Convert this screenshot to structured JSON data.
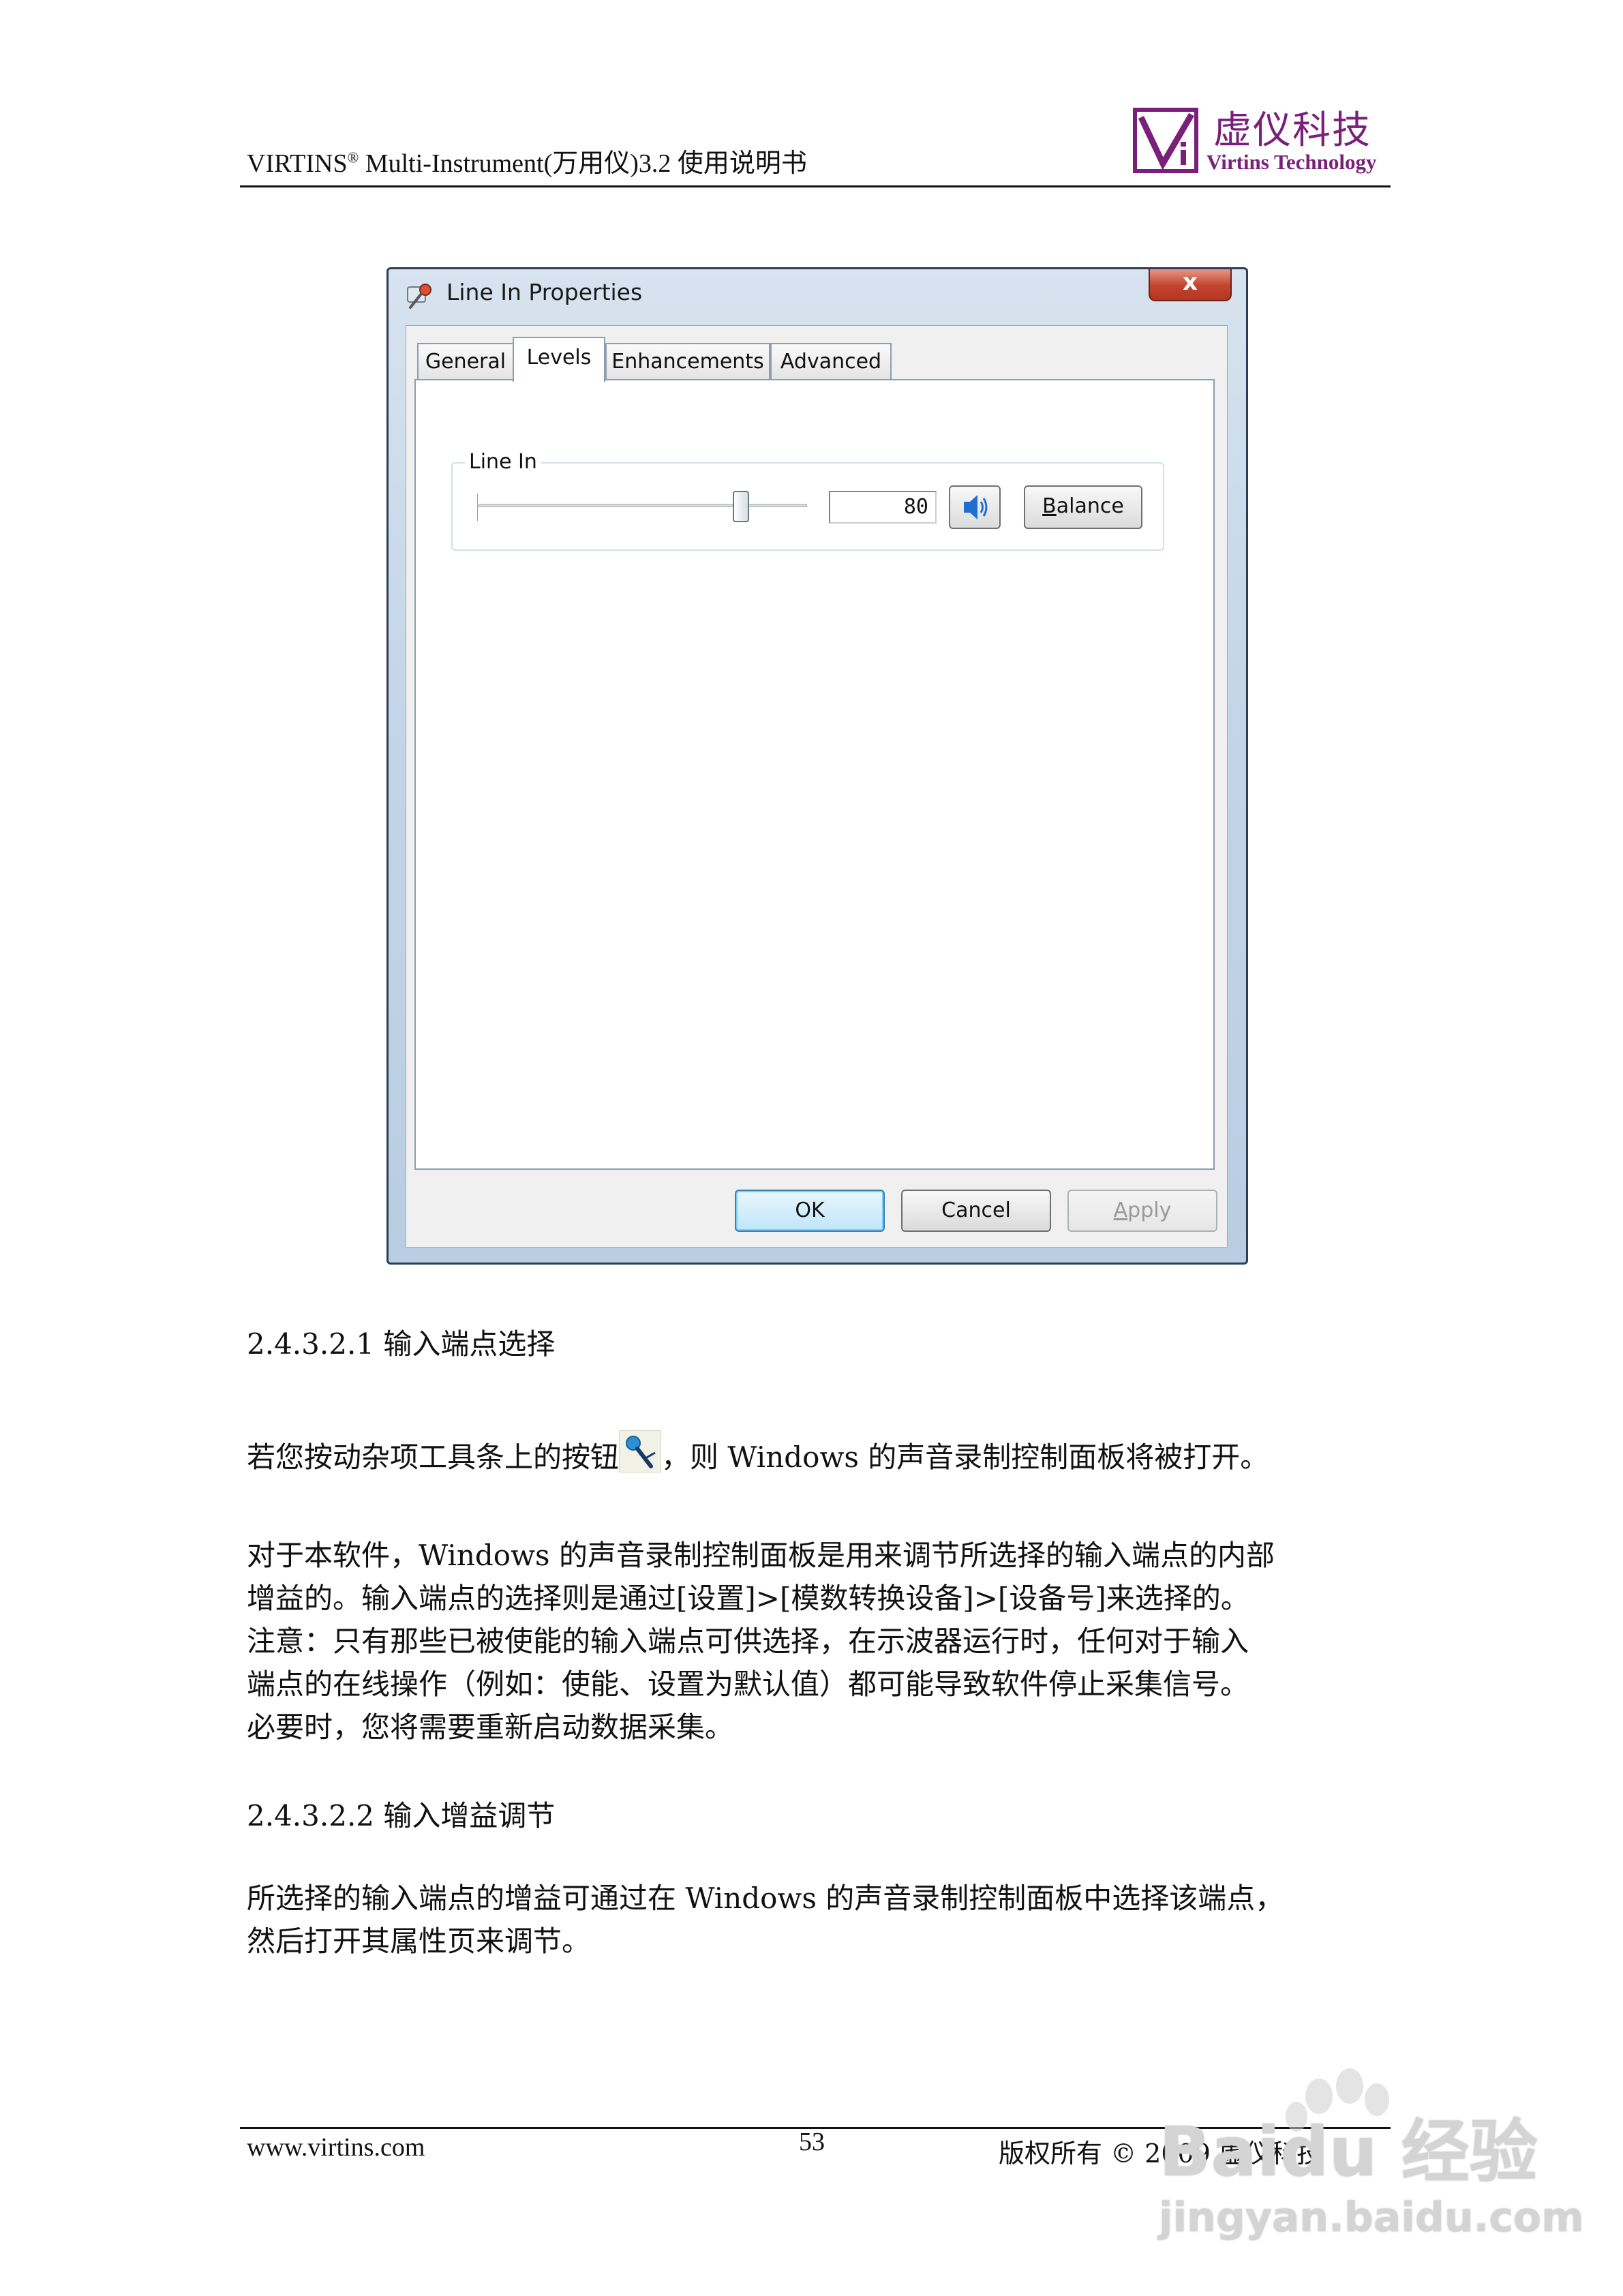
{
  "header": {
    "title_brand": "VIRTINS",
    "title_reg": "®",
    "title_rest": " Multi-Instrument(万用仪)3.2 使用说明书",
    "logo_cn": "虚仪科技",
    "logo_en": "Virtins Technology",
    "logo_color": "#7a1f7a"
  },
  "dialog": {
    "title": "Line In Properties",
    "close_glyph": "x",
    "tabs": [
      {
        "label": "General",
        "active": false
      },
      {
        "label": "Levels",
        "active": true
      },
      {
        "label": "Enhancements",
        "active": false
      },
      {
        "label": "Advanced",
        "active": false
      }
    ],
    "group_label": "Line In",
    "level_value": "80",
    "slider_fraction": 0.8,
    "speaker_icon": "speaker-icon",
    "balance_label_mnemonic": "B",
    "balance_label_rest": "alance",
    "ok_label": "OK",
    "cancel_label": "Cancel",
    "apply_label_mnemonic": "A",
    "apply_label_rest": "pply"
  },
  "body": {
    "section1_heading": "2.4.3.2.1 输入端点选择",
    "p1_before_icon": "若您按动杂项工具条上的按钮",
    "p1_icon": "microphone-icon",
    "p1_after_icon": "，则 Windows 的声音录制控制面板将被打开。",
    "p2_lines": [
      "对于本软件，Windows 的声音录制控制面板是用来调节所选择的输入端点的内部",
      "增益的。输入端点的选择则是通过[设置]>[模数转换设备]>[设备号]来选择的。",
      "注意：只有那些已被使能的输入端点可供选择，在示波器运行时，任何对于输入",
      "端点的在线操作（例如：使能、设置为默认值）都可能导致软件停止采集信号。",
      "必要时，您将需要重新启动数据采集。"
    ],
    "section2_heading": "2.4.3.2.2 输入增益调节",
    "p3_lines": [
      "所选择的输入端点的增益可通过在 Windows 的声音录制控制面板中选择该端点，",
      "然后打开其属性页来调节。"
    ]
  },
  "footer": {
    "url": "www.virtins.com",
    "page_number": "53",
    "copyright": "版权所有 © 2009 虚仪科技"
  },
  "watermark": {
    "line1": "Baidu 经验",
    "line2": "jingyan.baidu.com"
  }
}
